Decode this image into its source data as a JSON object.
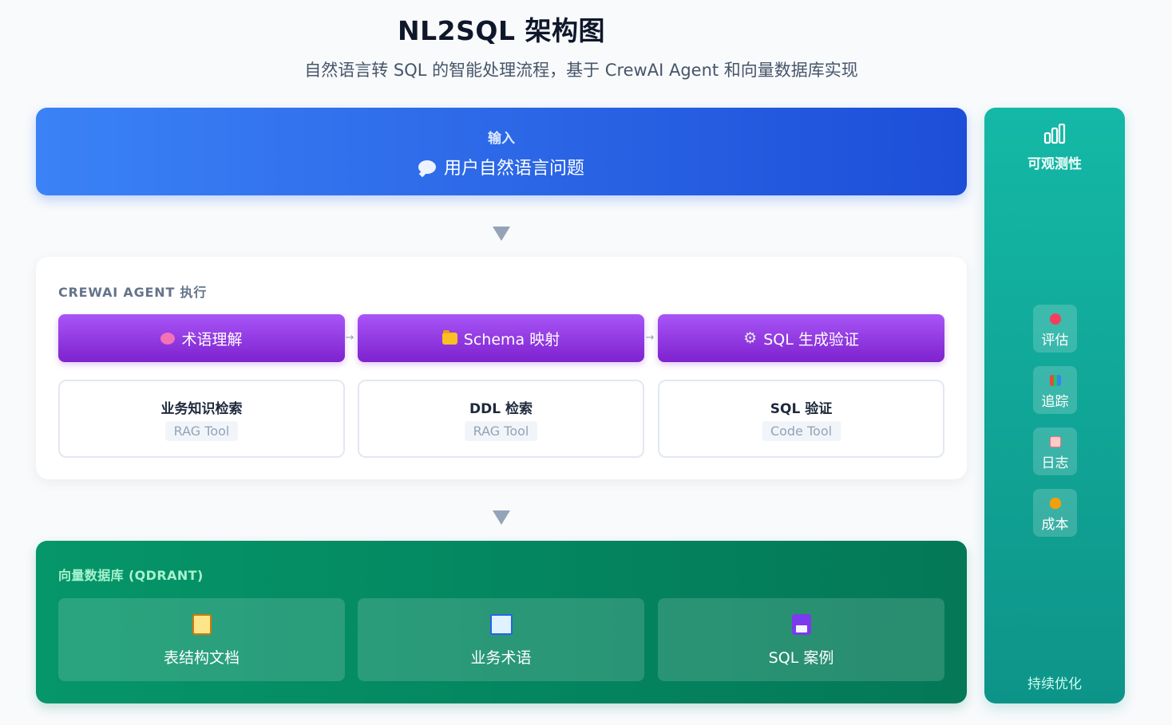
{
  "header": {
    "title": "NL2SQL 架构图",
    "subtitle": "自然语言转 SQL 的智能处理流程，基于 CrewAI Agent 和向量数据库实现"
  },
  "input": {
    "label": "输入",
    "question": "用户自然语言问题",
    "icon": "speech-bubble-icon"
  },
  "agent": {
    "title": "CREWAI AGENT 执行",
    "steps": [
      {
        "label": "术语理解",
        "icon": "brain-icon"
      },
      {
        "label": "Schema 映射",
        "icon": "folder-icon"
      },
      {
        "label": "SQL 生成验证",
        "icon": "gear-icon"
      }
    ],
    "flow_arrow": "→",
    "tools": [
      {
        "name": "业务知识检索",
        "tag": "RAG Tool"
      },
      {
        "name": "DDL 检索",
        "tag": "RAG Tool"
      },
      {
        "name": "SQL 验证",
        "tag": "Code Tool"
      }
    ]
  },
  "vector_db": {
    "title": "向量数据库 (QDRANT)",
    "items": [
      {
        "label": "表结构文档",
        "icon": "clipboard-icon"
      },
      {
        "label": "业务术语",
        "icon": "book-icon"
      },
      {
        "label": "SQL 案例",
        "icon": "floppy-disk-icon"
      }
    ]
  },
  "observability": {
    "title": "可观测性",
    "icon": "bar-chart-icon",
    "items": [
      {
        "label": "评估",
        "icon": "target-icon"
      },
      {
        "label": "追踪",
        "icon": "chart-icon"
      },
      {
        "label": "日志",
        "icon": "memo-icon"
      },
      {
        "label": "成本",
        "icon": "money-bag-icon"
      }
    ],
    "footer": "持续优化"
  },
  "colors": {
    "input_start": "#3b82f6",
    "input_end": "#1d4ed8",
    "step_start": "#a855f7",
    "step_end": "#7e22ce",
    "db_start": "#059669",
    "db_end": "#047857",
    "side_start": "#14b8a6",
    "side_end": "#0d9488",
    "arrow": "#94a3b8"
  }
}
